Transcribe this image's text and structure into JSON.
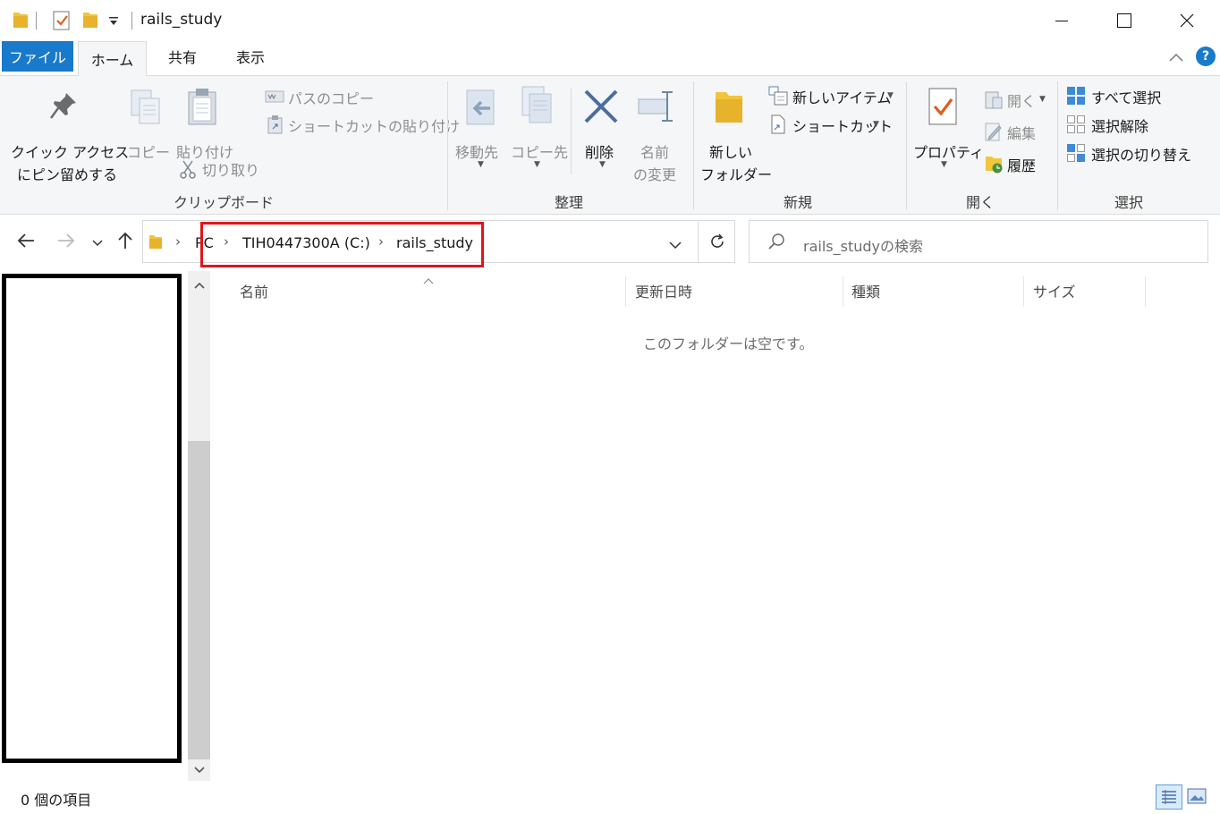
{
  "window": {
    "title": "rails_study"
  },
  "tabs": {
    "file": "ファイル",
    "home": "ホーム",
    "share": "共有",
    "view": "表示",
    "help": "?"
  },
  "ribbon": {
    "clipboard": {
      "pin_line1": "クイック アクセス",
      "pin_line2": "にピン留めする",
      "copy": "コピー",
      "paste": "貼り付け",
      "copy_path": "パスのコピー",
      "paste_shortcut": "ショートカットの貼り付け",
      "cut": "切り取り",
      "label": "クリップボード"
    },
    "organize": {
      "move_to": "移動先",
      "copy_to": "コピー先",
      "delete": "削除",
      "rename_line1": "名前",
      "rename_line2": "の変更",
      "label": "整理"
    },
    "new": {
      "new_folder_line1": "新しい",
      "new_folder_line2": "フォルダー",
      "new_item": "新しいアイテム",
      "shortcut": "ショートカット",
      "label": "新規"
    },
    "open": {
      "properties": "プロパティ",
      "open": "開く",
      "edit": "編集",
      "history": "履歴",
      "label": "開く"
    },
    "select": {
      "select_all": "すべて選択",
      "select_none": "選択解除",
      "invert": "選択の切り替え",
      "label": "選択"
    }
  },
  "address": {
    "crumbs": [
      "PC",
      "TIH0447300A (C:)",
      "rails_study"
    ],
    "search_placeholder": "rails_studyの検索"
  },
  "columns": {
    "name": "名前",
    "date": "更新日時",
    "type": "種類",
    "size": "サイズ"
  },
  "content": {
    "empty_message": "このフォルダーは空です。"
  },
  "status": {
    "item_count": "0 個の項目"
  },
  "colors": {
    "accent": "#1979ca",
    "highlight": "#e0141e",
    "folder": "#f2c53a"
  }
}
